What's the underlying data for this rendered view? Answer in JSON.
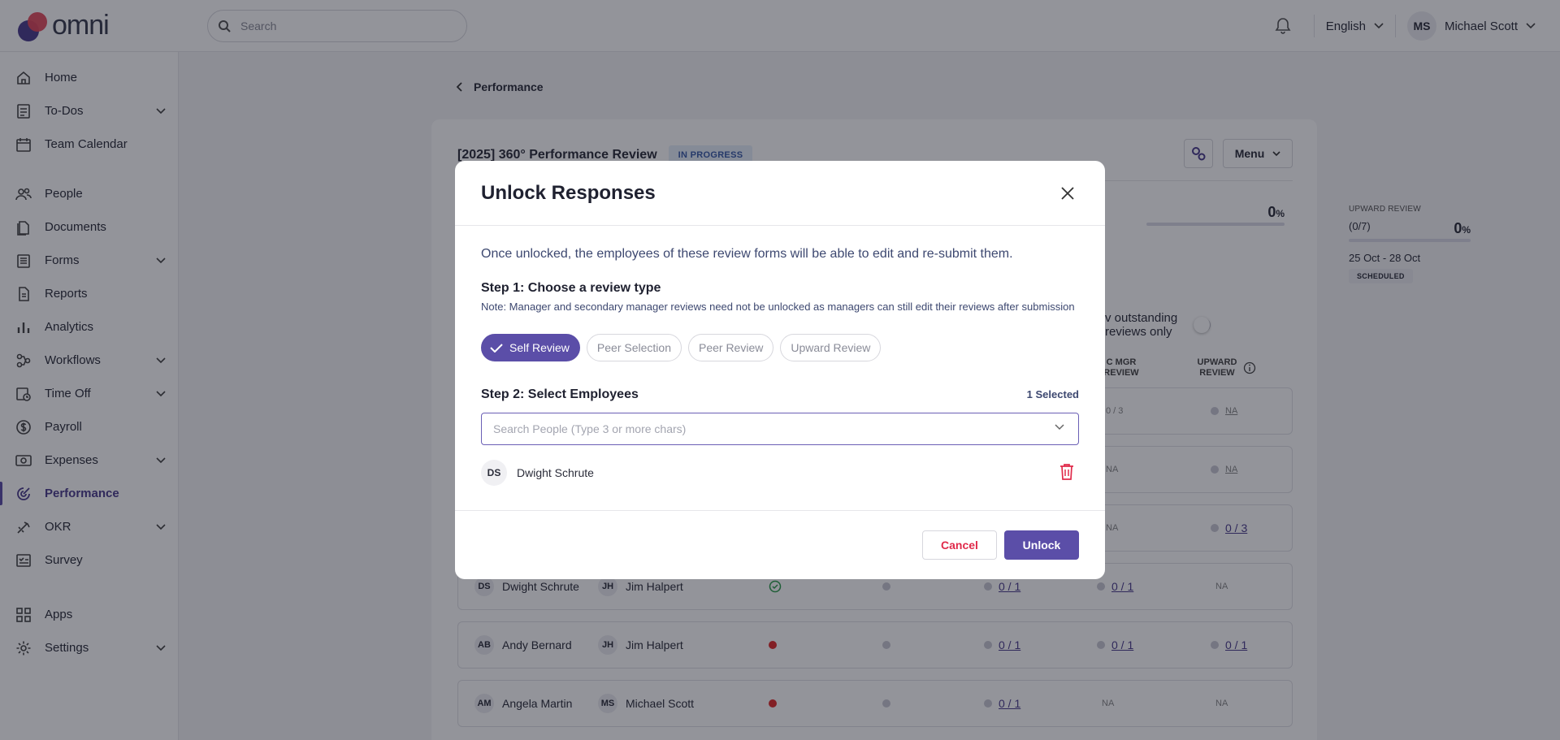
{
  "app": {
    "logo_text": "omni"
  },
  "topbar": {
    "search_placeholder": "Search",
    "language": "English",
    "user_initials": "MS",
    "user_name": "Michael Scott"
  },
  "sidebar": {
    "items": [
      {
        "label": "Home",
        "icon": "home-icon",
        "has_children": false
      },
      {
        "label": "To-Dos",
        "icon": "checklist-icon",
        "has_children": true
      },
      {
        "label": "Team Calendar",
        "icon": "calendar-icon",
        "has_children": false
      },
      {
        "label": "People",
        "icon": "people-icon",
        "has_children": false
      },
      {
        "label": "Documents",
        "icon": "documents-icon",
        "has_children": false
      },
      {
        "label": "Forms",
        "icon": "forms-icon",
        "has_children": true
      },
      {
        "label": "Reports",
        "icon": "reports-icon",
        "has_children": false
      },
      {
        "label": "Analytics",
        "icon": "analytics-icon",
        "has_children": false
      },
      {
        "label": "Workflows",
        "icon": "workflows-icon",
        "has_children": true
      },
      {
        "label": "Time Off",
        "icon": "time-off-icon",
        "has_children": true
      },
      {
        "label": "Payroll",
        "icon": "payroll-icon",
        "has_children": false
      },
      {
        "label": "Expenses",
        "icon": "expenses-icon",
        "has_children": true
      },
      {
        "label": "Performance",
        "icon": "performance-icon",
        "has_children": false,
        "active": true
      },
      {
        "label": "OKR",
        "icon": "okr-icon",
        "has_children": true
      },
      {
        "label": "Survey",
        "icon": "survey-icon",
        "has_children": false
      },
      {
        "label": "Apps",
        "icon": "apps-icon",
        "has_children": false
      },
      {
        "label": "Settings",
        "icon": "settings-icon",
        "has_children": true
      }
    ]
  },
  "page": {
    "breadcrumb": "Performance",
    "review_title": "[2025] 360° Performance Review",
    "status_badge": "IN PROGRESS",
    "menu_label": "Menu",
    "stat_partial_pct": "0",
    "upward_stat": {
      "label": "UPWARD REVIEW",
      "count": "(0/7)",
      "pct": "0",
      "pct_unit": "%",
      "progress": 0,
      "dates": "25 Oct - 28 Oct",
      "status": "SCHEDULED"
    },
    "outstanding_label": "v outstanding reviews only",
    "col_headers": {
      "sec_mgr": [
        "C MGR",
        "REVIEW"
      ],
      "upward": [
        "UPWARD",
        "REVIEW"
      ]
    },
    "na": "NA",
    "rows": [
      {
        "emp_i": "DS",
        "emp": "Dwight Schrute",
        "mgr_i": "JH",
        "mgr": "Jim Halpert",
        "self": "check",
        "peer_sel": "gray",
        "peer": "0 / 1",
        "sec": "0 / 1",
        "upward": "NA"
      },
      {
        "emp_i": "AB",
        "emp": "Andy Bernard",
        "mgr_i": "JH",
        "mgr": "Jim Halpert",
        "self": "red",
        "peer_sel": "gray",
        "peer": "0 / 1",
        "sec": "0 / 1",
        "upward": "0 / 1"
      },
      {
        "emp_i": "AM",
        "emp": "Angela Martin",
        "mgr_i": "MS",
        "mgr": "Michael Scott",
        "self": "red",
        "peer_sel": "gray",
        "peer": "0 / 1",
        "sec": "NA",
        "upward": "NA"
      }
    ],
    "hidden_rows_values": [
      "0 / 3",
      "NA",
      "NA",
      "NA",
      "NA",
      "0 / 3"
    ]
  },
  "modal": {
    "title": "Unlock Responses",
    "description": "Once unlocked, the employees of these review forms will be able to edit and re-submit them.",
    "step1_title": "Step 1: Choose a review type",
    "step1_note": "Note: Manager and secondary manager reviews need not be unlocked as managers can still edit their reviews after submission",
    "review_types": [
      {
        "label": "Self Review",
        "selected": true
      },
      {
        "label": "Peer Selection",
        "selected": false
      },
      {
        "label": "Peer Review",
        "selected": false
      },
      {
        "label": "Upward Review",
        "selected": false
      }
    ],
    "step2_title": "Step 2: Select Employees",
    "selected_count": "1 Selected",
    "search_placeholder": "Search People (Type 3 or more chars)",
    "search_value": "",
    "employees": [
      {
        "initials": "DS",
        "name": "Dwight Schrute"
      }
    ],
    "cancel_label": "Cancel",
    "unlock_label": "Unlock"
  },
  "colors": {
    "accent": "#5b4ea8",
    "danger": "#e02a4a",
    "status_red": "#e02a2a"
  }
}
